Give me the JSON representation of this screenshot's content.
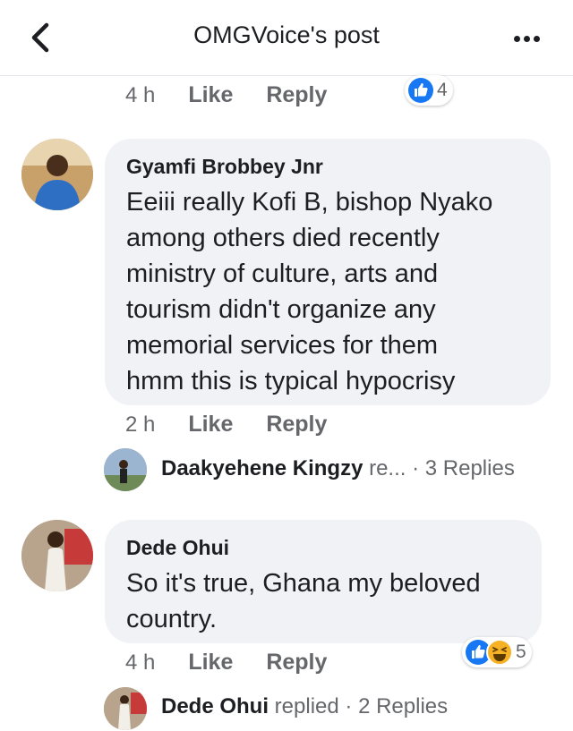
{
  "header": {
    "title": "OMGVoice's post"
  },
  "top_meta": {
    "time": "4 h",
    "like": "Like",
    "reply": "Reply",
    "reaction_count": "4"
  },
  "comments": [
    {
      "author": "Gyamfi Brobbey Jnr",
      "text_lines": [
        "Eeiii really Kofi B, bishop Nyako",
        "among others died recently",
        "ministry of culture, arts and",
        "tourism didn't organize any",
        "memorial services for them",
        "hmm this is typical hypocrisy"
      ],
      "time": "2 h",
      "like": "Like",
      "reply": "Reply",
      "replies_preview": {
        "name": "Daakyehene Kingzy",
        "suffix": " re...",
        "count_text": " · 3 Replies"
      }
    },
    {
      "author": "Dede Ohui",
      "text_lines": [
        "So it's true, Ghana my beloved",
        "country."
      ],
      "time": "4 h",
      "like": "Like",
      "reply": "Reply",
      "reaction_count": "5",
      "replies_preview": {
        "name": "Dede Ohui",
        "suffix": " replied",
        "count_text": " · 2 Replies"
      }
    }
  ],
  "colors": {
    "like_blue": "#1877f2",
    "haha_yellow": "#f7b125",
    "bubble": "#f0f2f5",
    "meta_gray": "#65676b"
  }
}
